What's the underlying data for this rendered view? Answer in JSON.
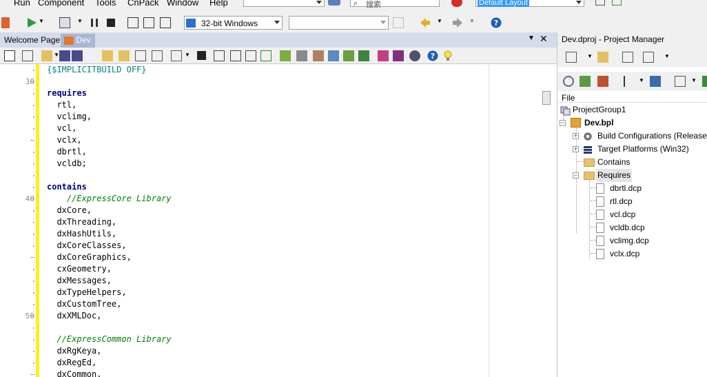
{
  "menu": [
    "Run",
    "Component",
    "Tools",
    "CnPack",
    "Window",
    "Help"
  ],
  "search": {
    "placeholder": "搜索"
  },
  "layout_combo": "Default Layout",
  "platform_combo": "32-bit Windows",
  "tabs": [
    {
      "label": "Welcome Page"
    },
    {
      "label": "Dev"
    }
  ],
  "editor": {
    "line_numbers": [
      "30",
      "40",
      "50"
    ],
    "lines": [
      {
        "parts": [
          {
            "t": "{$IMPLICITBUILD OFF}",
            "c": "dir"
          }
        ]
      },
      {
        "parts": []
      },
      {
        "parts": [
          {
            "t": "requires",
            "c": "kw"
          }
        ]
      },
      {
        "parts": [
          {
            "t": "  rtl,",
            "c": ""
          }
        ]
      },
      {
        "parts": [
          {
            "t": "  vclimg,",
            "c": ""
          }
        ]
      },
      {
        "parts": [
          {
            "t": "  vcl,",
            "c": ""
          }
        ]
      },
      {
        "parts": [
          {
            "t": "  vclx,",
            "c": ""
          }
        ]
      },
      {
        "parts": [
          {
            "t": "  dbrtl,",
            "c": ""
          }
        ]
      },
      {
        "parts": [
          {
            "t": "  vcldb;",
            "c": ""
          }
        ]
      },
      {
        "parts": []
      },
      {
        "parts": [
          {
            "t": "contains",
            "c": "kw"
          }
        ]
      },
      {
        "parts": [
          {
            "t": "    //ExpressCore Library",
            "c": "cm"
          }
        ]
      },
      {
        "parts": [
          {
            "t": "  dxCore,",
            "c": ""
          }
        ]
      },
      {
        "parts": [
          {
            "t": "  dxThreading,",
            "c": ""
          }
        ]
      },
      {
        "parts": [
          {
            "t": "  dxHashUtils,",
            "c": ""
          }
        ]
      },
      {
        "parts": [
          {
            "t": "  dxCoreClasses,",
            "c": ""
          }
        ]
      },
      {
        "parts": [
          {
            "t": "  dxCoreGraphics,",
            "c": ""
          }
        ]
      },
      {
        "parts": [
          {
            "t": "  cxGeometry,",
            "c": ""
          }
        ]
      },
      {
        "parts": [
          {
            "t": "  dxMessages,",
            "c": ""
          }
        ]
      },
      {
        "parts": [
          {
            "t": "  dxTypeHelpers,",
            "c": ""
          }
        ]
      },
      {
        "parts": [
          {
            "t": "  dxCustomTree,",
            "c": ""
          }
        ]
      },
      {
        "parts": [
          {
            "t": "  dxXMLDoc,",
            "c": ""
          }
        ]
      },
      {
        "parts": []
      },
      {
        "parts": [
          {
            "t": "  //ExpressCommon Library",
            "c": "cm"
          }
        ]
      },
      {
        "parts": [
          {
            "t": "  dxRgKeya,",
            "c": ""
          }
        ]
      },
      {
        "parts": [
          {
            "t": "  dxRegEd,",
            "c": ""
          }
        ]
      },
      {
        "parts": [
          {
            "t": "  dxCommon,",
            "c": ""
          }
        ]
      }
    ]
  },
  "project_manager": {
    "title": "Dev.dproj - Project Manager",
    "column_header": "File",
    "tree": [
      {
        "label": "ProjectGroup1",
        "kind": "group"
      },
      {
        "label": "Dev.bpl",
        "kind": "project"
      },
      {
        "label": "Build Configurations (Release)",
        "kind": "gear"
      },
      {
        "label": "Target Platforms (Win32)",
        "kind": "stack"
      },
      {
        "label": "Contains",
        "kind": "folder"
      },
      {
        "label": "Requires",
        "kind": "folder"
      },
      {
        "label": "dbrtl.dcp",
        "kind": "file"
      },
      {
        "label": "rtl.dcp",
        "kind": "file"
      },
      {
        "label": "vcl.dcp",
        "kind": "file"
      },
      {
        "label": "vcldb.dcp",
        "kind": "file"
      },
      {
        "label": "vclimg.dcp",
        "kind": "file"
      },
      {
        "label": "vclx.dcp",
        "kind": "file"
      }
    ]
  },
  "colors": {
    "accent_yellow": "#fcee21",
    "keyword": "#000080",
    "comment": "#008000",
    "directive": "#008080",
    "selection": "#3399ff"
  }
}
